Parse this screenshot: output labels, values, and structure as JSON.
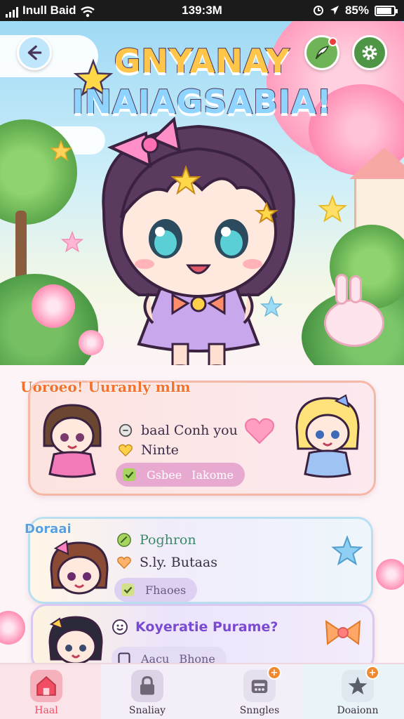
{
  "status_bar": {
    "carrier": "Inull Baid",
    "time": "139:3M",
    "battery": "85%"
  },
  "header": {
    "title_line1": "GNYANAY",
    "title_line2": "INAIAGSABIA!"
  },
  "cards": [
    {
      "tag": "Uoroeo! Uuranly mlm",
      "rows": [
        "baal Conh you",
        "Ninte"
      ],
      "pill": [
        "Gsbee",
        "Iakome"
      ]
    },
    {
      "tag": "Doraai",
      "rows": [
        "Poghron",
        "S.ly. Butaas"
      ],
      "pill": [
        "Fhaoes"
      ]
    },
    {
      "rows": [
        "Koyeratie Purame?"
      ],
      "pill": [
        "Aacu",
        "Bhone"
      ]
    }
  ],
  "nav": [
    {
      "label": "Haal",
      "icon": "home-icon",
      "active": true
    },
    {
      "label": "Snaliay",
      "icon": "lock-icon"
    },
    {
      "label": "Snngles",
      "icon": "inbox-icon",
      "badge": "+"
    },
    {
      "label": "Doaionn",
      "icon": "star-icon",
      "badge": "+"
    }
  ],
  "colors": {
    "accent_pink": "#f25c7d",
    "card1_bg": "#fde3df",
    "card2_bg": "#f1ecfa",
    "card3_bg": "#ece4fb",
    "nav_active": "#f24e63"
  }
}
